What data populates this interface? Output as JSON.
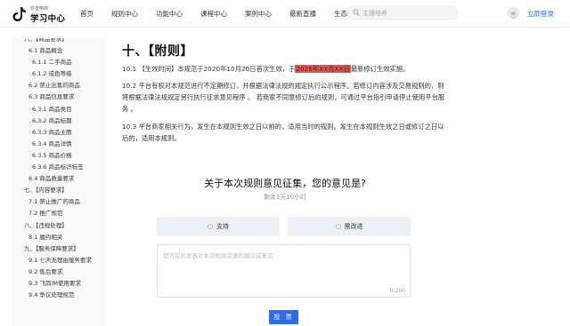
{
  "header": {
    "logo_small": "抖音电商",
    "logo_main": "学习中心",
    "nav": [
      {
        "label": "首页",
        "dropdown": false
      },
      {
        "label": "规则中心",
        "dropdown": false
      },
      {
        "label": "功能中心",
        "dropdown": false
      },
      {
        "label": "课程中心",
        "dropdown": false
      },
      {
        "label": "案例中心",
        "dropdown": false
      },
      {
        "label": "最新直播",
        "dropdown": false
      },
      {
        "label": "生态伙伴",
        "dropdown": true
      }
    ],
    "search_placeholder": "主播培养",
    "login": "立即登录"
  },
  "sidebar": {
    "items": [
      {
        "label": "六、【商品要求】",
        "level": 1
      },
      {
        "label": "6.1 商品概念",
        "level": 2
      },
      {
        "label": "6.1.1 二手商品",
        "level": 3
      },
      {
        "label": "6.1.2 成色等级",
        "level": 3
      },
      {
        "label": "6.2 禁止出售的商品",
        "level": 2
      },
      {
        "label": "6.3 商品信息要求",
        "level": 2
      },
      {
        "label": "6.3.1 商品类目",
        "level": 3
      },
      {
        "label": "6.3.2 商品标题",
        "level": 3
      },
      {
        "label": "6.3.3 商品主图",
        "level": 3
      },
      {
        "label": "6.3.4 商品详情",
        "level": 3
      },
      {
        "label": "6.3.5 商品价格",
        "level": 3
      },
      {
        "label": "6.3.6 商品标识标签",
        "level": 3
      },
      {
        "label": "6.4 商品质量要求",
        "level": 2
      },
      {
        "label": "七、【内容要求】",
        "level": 1
      },
      {
        "label": "7.1 禁止推广的商品",
        "level": 2
      },
      {
        "label": "7.2 推广规范",
        "level": 2
      },
      {
        "label": "八、【违规处理】",
        "level": 1
      },
      {
        "label": "8.1 履约相关",
        "level": 2
      },
      {
        "label": "九、【服务保障要求】",
        "level": 1
      },
      {
        "label": "9.1 七天无理由服务要求",
        "level": 2
      },
      {
        "label": "9.2 售后要求",
        "level": 2
      },
      {
        "label": "9.3 飞鸽IM使用要求",
        "level": 2
      },
      {
        "label": "9.4 争议处理规范",
        "level": 2
      }
    ]
  },
  "content": {
    "section_title": "十、【附则】",
    "p1_before": "10.1 【生效时间】本规范于2020年10月20日首次生效，于",
    "p1_highlight": "2026年XX月XX日",
    "p1_after": "最新修订生效实施。",
    "p2": "10.2 平台有权对本规范进行不定期修订，并根据法律法规的规定执行公示程序。若修订内容涉及交易规则的，则将根据法律法规规定另行执行征求意见程序 。 若商家不同意修订后的规则，可通过平台指引申请停止使用平台服务 。",
    "p3": "10.3 平台商家相关行为，发生在本规则生效之日以前的，适用当时的规则。发生在本规则生效之日或修订之日以后的，适用本规则。"
  },
  "feedback": {
    "title": "关于本次规则意见征集，您的意见是?",
    "remaining": "剩余3天10小时",
    "option_support": "支持",
    "option_modify": "需改进",
    "textarea_placeholder": "您可在此发表对本次规则变更的建议或意见",
    "counter": "0/200",
    "submit": "投 票"
  },
  "colors": {
    "accent": "#2e6be6",
    "highlight": "#e8534d",
    "sidebar_bg": "#f8f9fb",
    "option_bg": "#eef0f7"
  }
}
